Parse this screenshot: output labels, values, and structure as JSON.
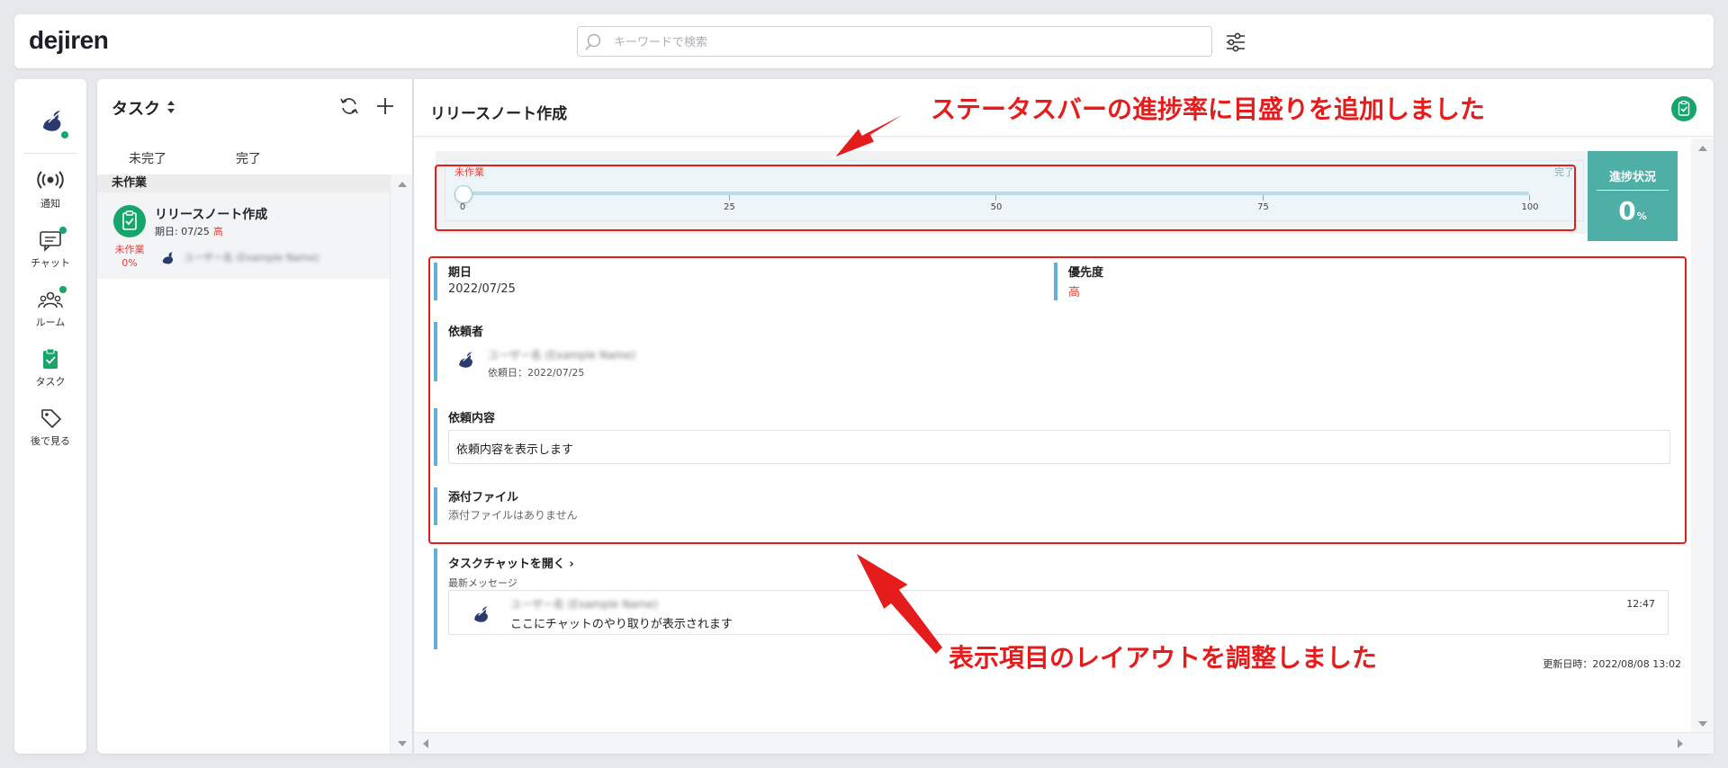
{
  "app": {
    "logo": "dejiren"
  },
  "search": {
    "placeholder": "キーワードで検索"
  },
  "nav": {
    "items": [
      {
        "label": "通知"
      },
      {
        "label": "チャット"
      },
      {
        "label": "ルーム"
      },
      {
        "label": "タスク"
      },
      {
        "label": "後で見る"
      }
    ]
  },
  "task_panel": {
    "title": "タスク",
    "tabs": [
      {
        "label": "未完了"
      },
      {
        "label": "完了"
      }
    ],
    "section": "未作業",
    "task": {
      "title": "リリースノート作成",
      "due": "期日: 07/25",
      "priority": "高",
      "status": "未作業",
      "progress": "0%",
      "assignee": "ユーザー名 (Example Name)"
    }
  },
  "detail": {
    "title": "リリースノート作成",
    "status_bar": {
      "start_label": "未作業",
      "end_label": "完了",
      "value": 0,
      "ticks": [
        "0",
        "25",
        "50",
        "75",
        "100"
      ]
    },
    "progress": {
      "label": "進捗状況",
      "value": "0",
      "unit": "%"
    },
    "due": {
      "label": "期日",
      "value": "2022/07/25"
    },
    "priority": {
      "label": "優先度",
      "value": "高"
    },
    "requester": {
      "label": "依頼者",
      "name": "ユーザー名 (Example Name)",
      "date": "依頼日：2022/07/25"
    },
    "content": {
      "label": "依頼内容",
      "value": "依頼内容を表示します"
    },
    "attachment": {
      "label": "添付ファイル",
      "value": "添付ファイルはありません"
    },
    "chat": {
      "open_label": "タスクチャットを開く",
      "latest_label": "最新メッセージ",
      "sender": "ユーザー名 (Example Name)",
      "message": "ここにチャットのやり取りが表示されます",
      "time": "12:47"
    },
    "updated": "更新日時：2022/08/08 13:02"
  },
  "annotations": {
    "status_bar": "ステータスバーの進捗率に目盛りを追加しました",
    "layout": "表示項目のレイアウトを調整しました"
  },
  "colors": {
    "accent_green": "#16a56b",
    "task_teal": "#4eafa6",
    "priority_red": "#e3413a",
    "field_bar_blue": "#62b0d5",
    "annotation_red": "#e51c1c"
  }
}
